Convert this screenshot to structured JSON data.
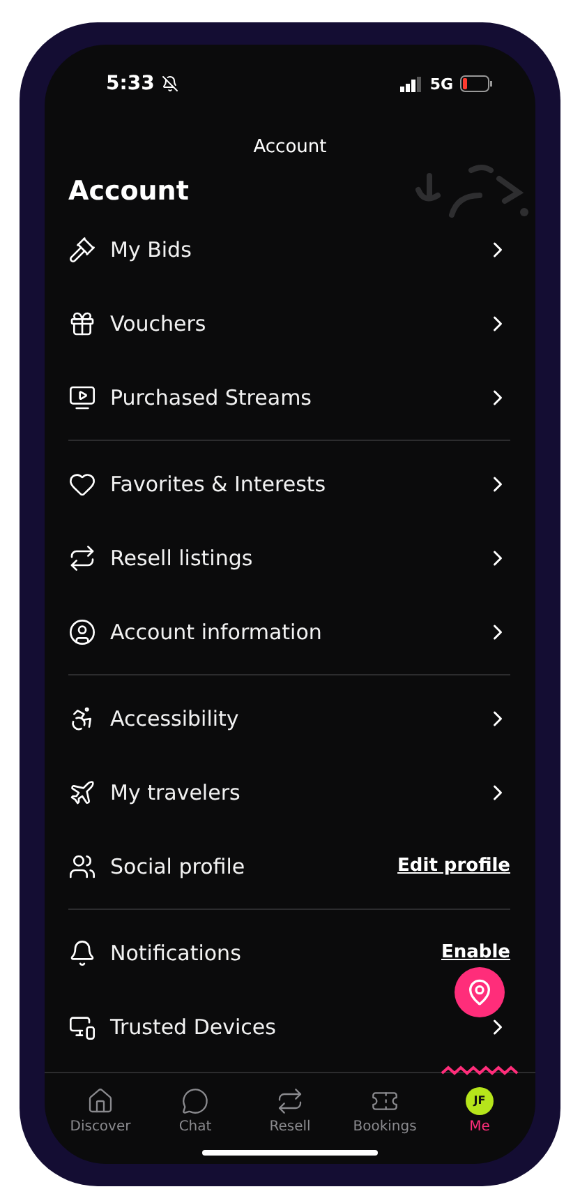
{
  "status_bar": {
    "time": "5:33",
    "network": "5G"
  },
  "header": {
    "title": "Account"
  },
  "page_title": "Account",
  "sections": [
    {
      "items": [
        {
          "label": "My Bids",
          "kind": "chevron"
        },
        {
          "label": "Vouchers",
          "kind": "chevron"
        },
        {
          "label": "Purchased Streams",
          "kind": "chevron"
        }
      ]
    },
    {
      "items": [
        {
          "label": "Favorites & Interests",
          "kind": "chevron"
        },
        {
          "label": "Resell listings",
          "kind": "chevron"
        },
        {
          "label": "Account information",
          "kind": "chevron"
        }
      ]
    },
    {
      "items": [
        {
          "label": "Accessibility",
          "kind": "chevron"
        },
        {
          "label": "My travelers",
          "kind": "chevron"
        },
        {
          "label": "Social profile",
          "kind": "link",
          "action": "Edit profile"
        }
      ]
    },
    {
      "items": [
        {
          "label": "Notifications",
          "kind": "link",
          "action": "Enable"
        },
        {
          "label": "Trusted Devices",
          "kind": "chevron"
        }
      ]
    }
  ],
  "tabs": [
    {
      "label": "Discover",
      "selected": false
    },
    {
      "label": "Chat",
      "selected": false
    },
    {
      "label": "Resell",
      "selected": false
    },
    {
      "label": "Bookings",
      "selected": false
    },
    {
      "label": "Me",
      "initials": "JF",
      "selected": true
    }
  ]
}
